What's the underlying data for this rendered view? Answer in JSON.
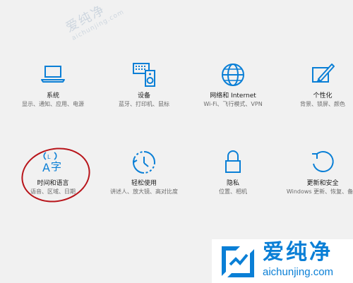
{
  "watermark": {
    "cn": "爱纯净",
    "en": "aichunjing.com"
  },
  "tiles": [
    {
      "title": "系统",
      "desc": "显示、通知、应用、电源",
      "icon": "laptop-icon"
    },
    {
      "title": "设备",
      "desc": "蓝牙、打印机、鼠标",
      "icon": "devices-icon"
    },
    {
      "title": "网络和 Internet",
      "desc": "Wi-Fi、飞行模式、VPN",
      "icon": "globe-icon"
    },
    {
      "title": "个性化",
      "desc": "背景、锁屏、颜色",
      "icon": "personalization-icon"
    },
    {
      "title": "时间和语言",
      "desc": "语音、区域、日期",
      "icon": "time-language-icon"
    },
    {
      "title": "轻松使用",
      "desc": "讲述人、放大镜、高对比度",
      "icon": "ease-of-access-icon"
    },
    {
      "title": "隐私",
      "desc": "位置、相机",
      "icon": "lock-icon"
    },
    {
      "title": "更新和安全",
      "desc": "Windows 更新、恢复、备份",
      "icon": "update-icon"
    }
  ],
  "colors": {
    "accent": "#0a7fd6",
    "annotation": "#b8141a",
    "background": "#f1f1f1"
  }
}
